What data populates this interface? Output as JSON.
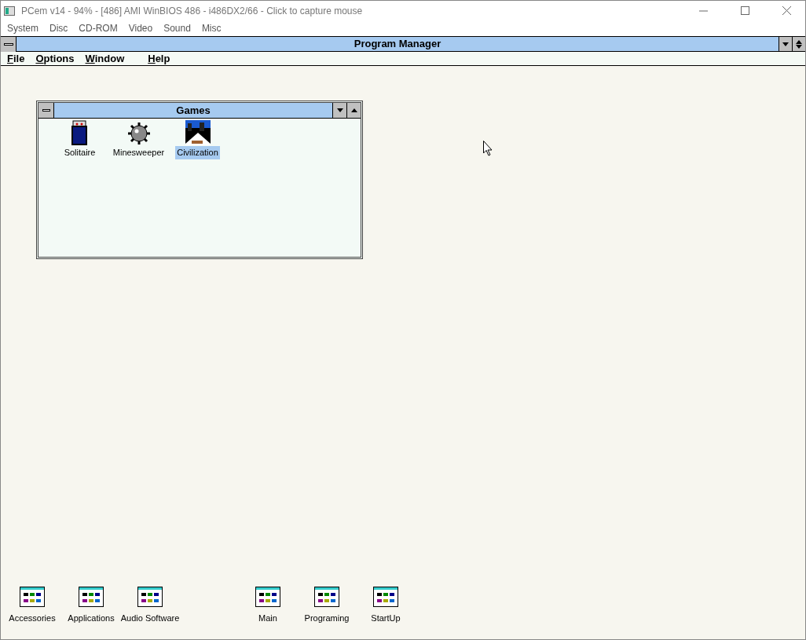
{
  "window": {
    "title": "PCem v14 - 94% - [486] AMI WinBIOS 486 - i486DX2/66 - Click to capture mouse"
  },
  "menu": [
    "System",
    "Disc",
    "CD-ROM",
    "Video",
    "Sound",
    "Misc"
  ],
  "program_manager": {
    "title": "Program Manager",
    "menu": [
      "File",
      "Options",
      "Window",
      "Help"
    ]
  },
  "group_window": {
    "title": "Games",
    "items": [
      {
        "label": "Solitaire",
        "kind": "cards",
        "selected": false
      },
      {
        "label": "Minesweeper",
        "kind": "mine",
        "selected": false
      },
      {
        "label": "Civilization",
        "kind": "city",
        "selected": true
      }
    ]
  },
  "minimized_groups": [
    "Accessories",
    "Applications",
    "Audio Software",
    "Main",
    "Programing",
    "StartUp"
  ]
}
